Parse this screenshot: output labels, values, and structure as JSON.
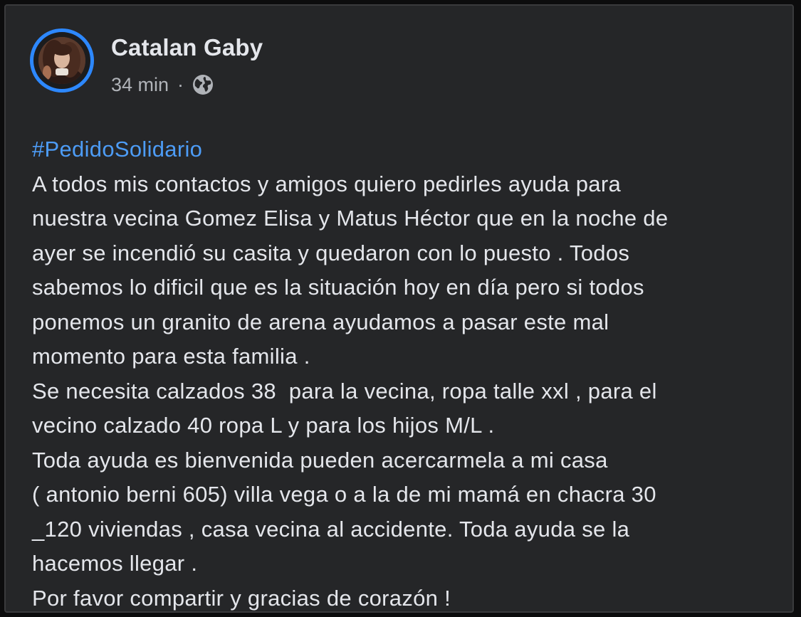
{
  "post": {
    "author": "Catalan Gaby",
    "timestamp": "34 min",
    "separator": "·",
    "audience_icon": "globe-icon",
    "hashtag": "#PedidoSolidario",
    "lines": [
      "A todos mis contactos y amigos quiero pedirles ayuda para",
      "nuestra vecina Gomez Elisa y Matus Héctor que en la noche de",
      "ayer se incendió su casita y quedaron con lo puesto . Todos",
      "sabemos lo dificil que es la situación hoy en día pero si todos",
      "ponemos un granito de arena ayudamos a pasar este mal",
      "momento para esta familia .",
      "Se necesita calzados 38  para la vecina, ropa talle xxl , para el",
      "vecino calzado 40 ropa L y para los hijos M/L .",
      "Toda ayuda es bienvenida pueden acercarmela a mi casa",
      "( antonio berni 605) villa vega o a la de mi mamá en chacra 30",
      "_120 viviendas , casa vecina al accidente. Toda ayuda se la",
      "hacemos llegar .",
      "Por favor compartir y gracias de corazón !"
    ]
  },
  "colors": {
    "background": "#252628",
    "text": "#e4e6eb",
    "secondary_text": "#b0b3b8",
    "hashtag": "#4d9cf6",
    "avatar_ring": "#2d88ff"
  }
}
